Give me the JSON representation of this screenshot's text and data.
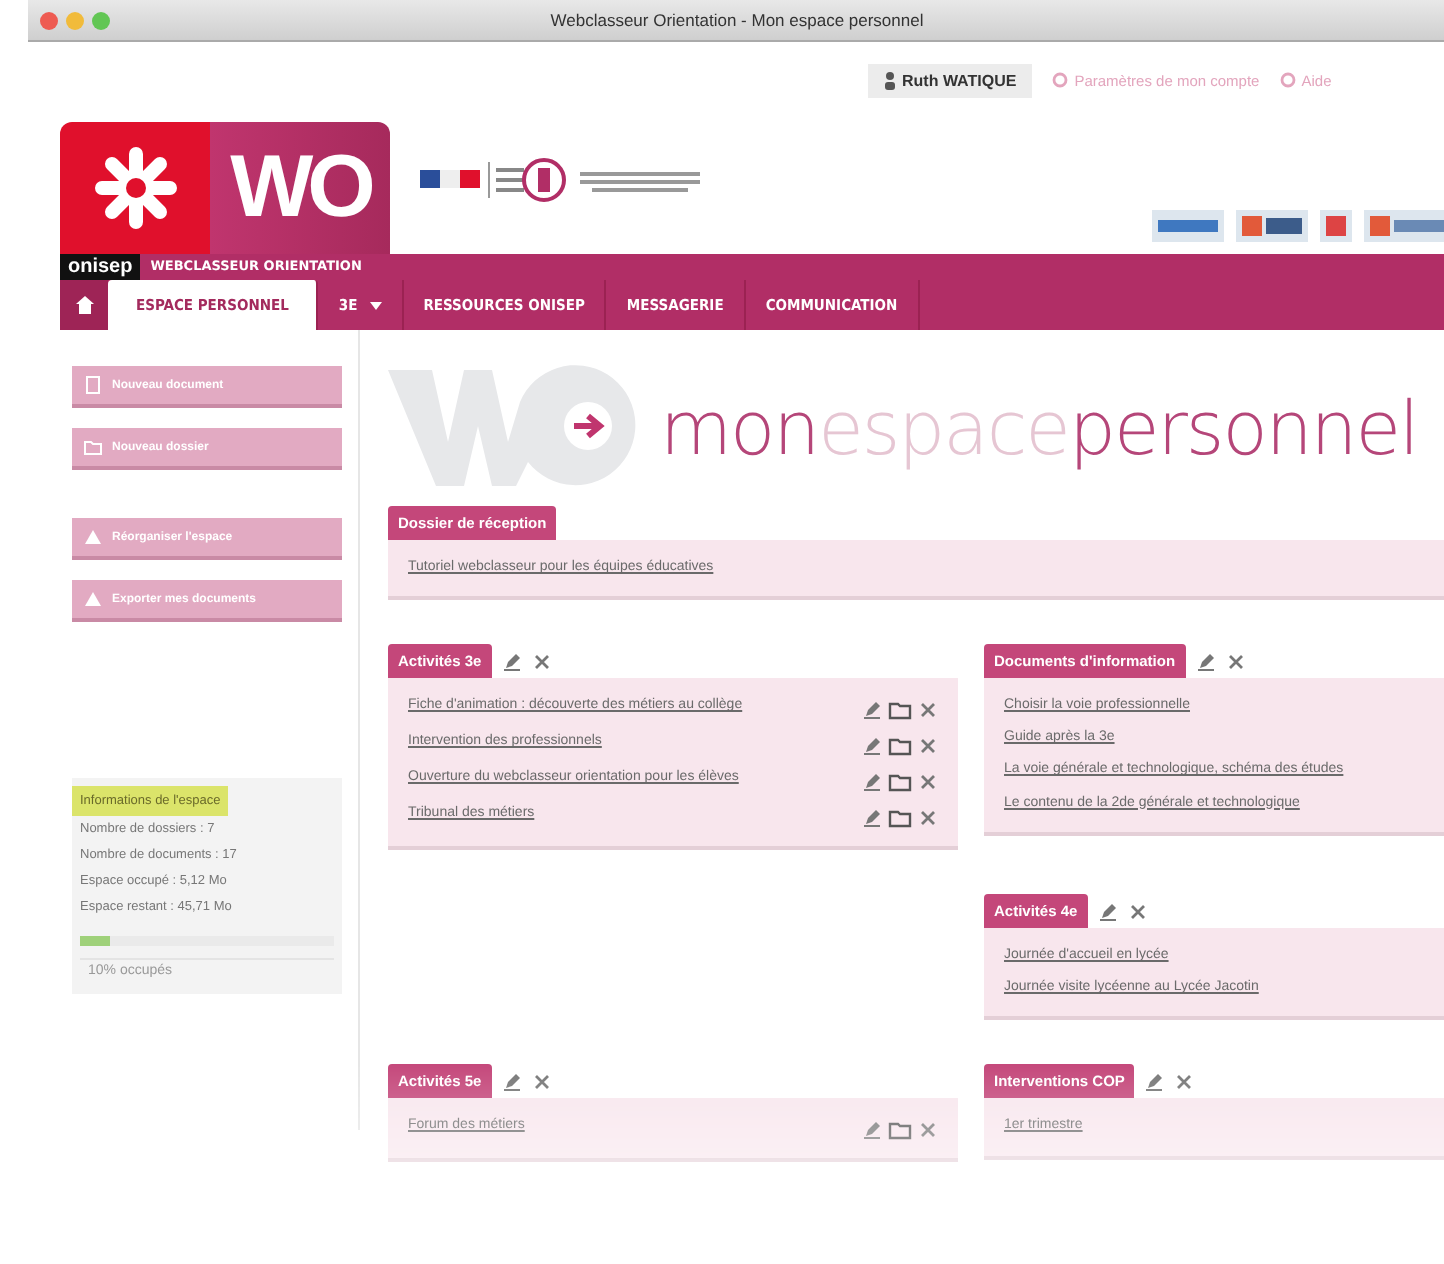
{
  "window": {
    "title": "Webclasseur Orientation - Mon espace personnel"
  },
  "user_bar": {
    "user": "Ruth WATIQUE",
    "links": [
      "Paramètres de mon compte",
      "Aide"
    ]
  },
  "logo": {
    "mark": "WO",
    "brand": "onisep",
    "subtitle": "WEBCLASSEUR ORIENTATION"
  },
  "nav": [
    {
      "label": "ESPACE PERSONNEL",
      "selected": true,
      "kind": "tab"
    },
    {
      "label": "3E",
      "selected": false,
      "kind": "dropdown"
    },
    {
      "label": "RESSOURCES ONISEP",
      "selected": false,
      "kind": "tab"
    },
    {
      "label": "MESSAGERIE",
      "selected": false,
      "kind": "tab"
    },
    {
      "label": "COMMUNICATION",
      "selected": false,
      "kind": "tab"
    }
  ],
  "sidebar": {
    "actions": [
      {
        "label": "Nouveau document",
        "kind": "document"
      },
      {
        "label": "Nouveau dossier",
        "kind": "folder"
      },
      {
        "label": "Réorganiser l'espace",
        "kind": "upload"
      },
      {
        "label": "Exporter mes documents",
        "kind": "upload"
      }
    ],
    "info": {
      "title": "Informations de l'espace",
      "lines": [
        "Nombre de dossiers : 7",
        "Nombre de documents : 17",
        "Espace occupé : 5,12 Mo",
        "Espace restant : 45,71 Mo"
      ],
      "level": 0.12,
      "caption": "10% occupés"
    }
  },
  "heading": [
    {
      "text": "mon",
      "kind": "strong"
    },
    {
      "text": "espace",
      "kind": "faint"
    },
    {
      "text": "personnel",
      "kind": "strong"
    }
  ],
  "inbox": {
    "title": "Dossier de réception",
    "editable": false,
    "item_actions": false,
    "items": [
      "Tutoriel webclasseur pour les équipes éducatives"
    ]
  },
  "columns": [
    {
      "panels": [
        {
          "title": "Activités 3e",
          "editable": true,
          "item_actions": true,
          "items": [
            "Fiche d'animation : découverte des métiers au collège",
            "Intervention des professionnels",
            "Ouverture du webclasseur orientation pour les élèves",
            "Tribunal des métiers"
          ]
        },
        {
          "title": "Activités 5e",
          "editable": true,
          "item_actions": true,
          "items": [
            "Forum des métiers"
          ]
        }
      ]
    },
    {
      "panels": [
        {
          "title": "Documents d'information",
          "editable": true,
          "item_actions": false,
          "items": [
            "Choisir la voie professionnelle",
            "Guide après la 3e",
            "La voie générale et technologique, schéma des études",
            "Le contenu de la 2de générale et technologique"
          ]
        },
        {
          "title": "Activités 4e",
          "editable": true,
          "item_actions": false,
          "items": [
            "Journée d'accueil en lycée",
            "Journée visite lycéenne au Lycée Jacotin"
          ]
        },
        {
          "title": "Interventions COP",
          "editable": true,
          "item_actions": false,
          "items": [
            "1er trimestre"
          ]
        }
      ]
    }
  ]
}
